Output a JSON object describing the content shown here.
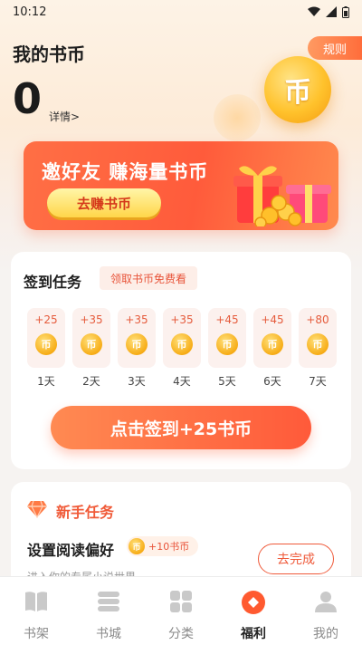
{
  "status_bar": {
    "time": "10:12"
  },
  "header": {
    "title": "我的书币",
    "rules_label": "规则",
    "balance": "0",
    "detail_label": "详情>",
    "coin_glyph": "币"
  },
  "invite_banner": {
    "title": "邀好友 赚海量书币",
    "button_label": "去赚书币"
  },
  "signin": {
    "title": "签到任务",
    "tag": "领取书币免费看",
    "coin_glyph": "币",
    "days": [
      {
        "reward": "+25",
        "label": "1天"
      },
      {
        "reward": "+35",
        "label": "2天"
      },
      {
        "reward": "+35",
        "label": "3天"
      },
      {
        "reward": "+35",
        "label": "4天"
      },
      {
        "reward": "+45",
        "label": "5天"
      },
      {
        "reward": "+45",
        "label": "6天"
      },
      {
        "reward": "+80",
        "label": "7天"
      }
    ],
    "checkin_button": "点击签到+25书币"
  },
  "newbie": {
    "title": "新手任务",
    "task_name": "设置阅读偏好",
    "task_reward": "+10书币",
    "task_coin_glyph": "币",
    "task_desc": "进入你的专属小说世界",
    "complete_button": "去完成"
  },
  "tab_bar": {
    "items": [
      {
        "label": "书架",
        "icon": "book-icon"
      },
      {
        "label": "书城",
        "icon": "bookstore-icon"
      },
      {
        "label": "分类",
        "icon": "grid-icon"
      },
      {
        "label": "福利",
        "icon": "welfare-icon"
      },
      {
        "label": "我的",
        "icon": "profile-icon"
      }
    ],
    "active": "福利"
  },
  "colors": {
    "accent": "#ff5a3a",
    "coin": "#f7ad17",
    "tab_active": "#ff5a30",
    "tab_inactive": "#c9c9c9"
  }
}
